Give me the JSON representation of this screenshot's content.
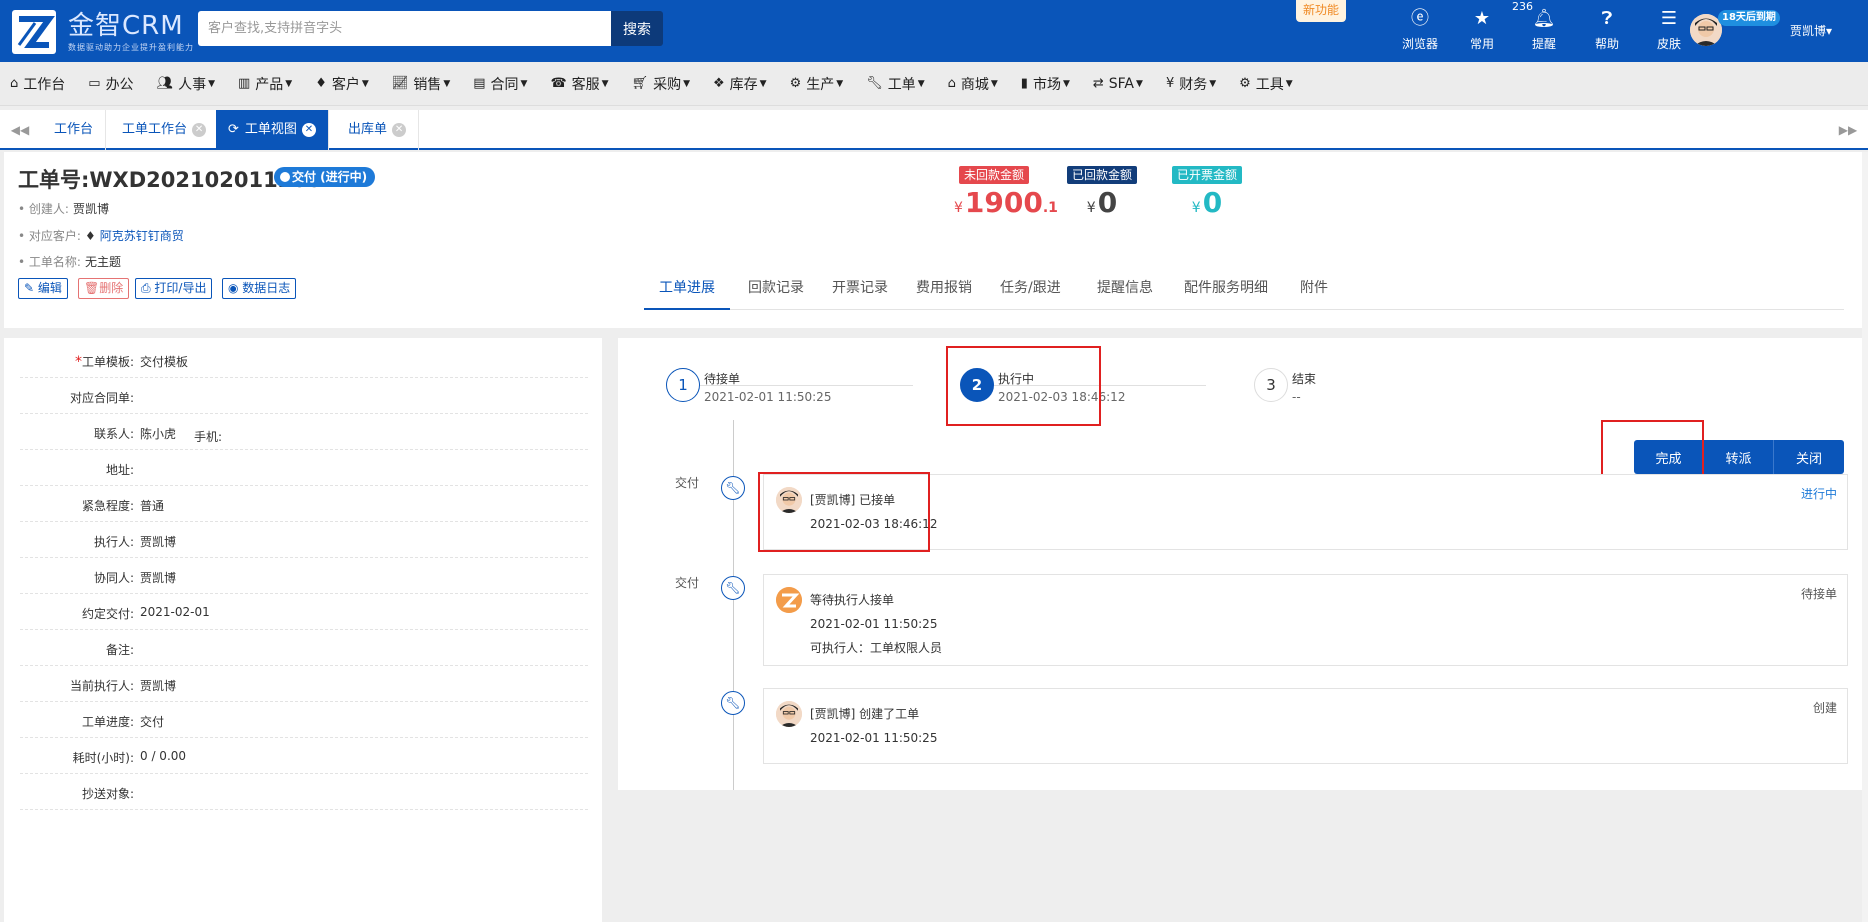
{
  "app": {
    "name": "金智CRM",
    "slogan": "数据驱动助力企业提升盈利能力",
    "search_placeholder": "客户查找,支持拼音字头",
    "search_button": "搜索",
    "new_feature": "新功能",
    "tools": [
      {
        "label": "浏览器",
        "icon": "browser-icon"
      },
      {
        "label": "常用",
        "icon": "star-icon"
      },
      {
        "label": "提醒",
        "icon": "bell-icon",
        "badge": "236"
      },
      {
        "label": "帮助",
        "icon": "help-icon"
      },
      {
        "label": "皮肤",
        "icon": "skin-icon"
      }
    ],
    "trial_badge": "18天后到期",
    "user": "贾凯博▾"
  },
  "menu": [
    {
      "label": "工作台",
      "icon": "home-icon",
      "dropdown": false
    },
    {
      "label": "办公",
      "icon": "laptop-icon",
      "dropdown": false
    },
    {
      "label": "人事",
      "icon": "users-icon",
      "dropdown": true
    },
    {
      "label": "产品",
      "icon": "barcode-icon",
      "dropdown": true
    },
    {
      "label": "客户",
      "icon": "diamond-icon",
      "dropdown": true
    },
    {
      "label": "销售",
      "icon": "chart-icon",
      "dropdown": true
    },
    {
      "label": "合同",
      "icon": "contract-icon",
      "dropdown": true
    },
    {
      "label": "客服",
      "icon": "phone-icon",
      "dropdown": true
    },
    {
      "label": "采购",
      "icon": "cart-icon",
      "dropdown": true
    },
    {
      "label": "库存",
      "icon": "cubes-icon",
      "dropdown": true
    },
    {
      "label": "生产",
      "icon": "cogs-icon",
      "dropdown": true
    },
    {
      "label": "工单",
      "icon": "wrench-icon",
      "dropdown": true
    },
    {
      "label": "商城",
      "icon": "shop-icon",
      "dropdown": true
    },
    {
      "label": "市场",
      "icon": "bookmark-icon",
      "dropdown": true
    },
    {
      "label": "SFA",
      "icon": "retweet-icon",
      "dropdown": true
    },
    {
      "label": "财务",
      "icon": "yen-icon",
      "dropdown": true
    },
    {
      "label": "工具",
      "icon": "gear-icon",
      "dropdown": true
    }
  ],
  "tabs": [
    {
      "label": "工作台",
      "closable": false,
      "active": false
    },
    {
      "label": "工单工作台",
      "closable": true,
      "active": false
    },
    {
      "label": "工单视图",
      "closable": true,
      "active": true
    },
    {
      "label": "出库单",
      "closable": true,
      "active": false
    }
  ],
  "order": {
    "title": "工单号:WXD2021020112002",
    "status": "交付 (进行中)",
    "creator_label": "创建人:",
    "creator": "贾凯博",
    "customer_label": "对应客户:",
    "customer": "阿克苏钉钉商贸",
    "name_label": "工单名称:",
    "name": "无主题",
    "actions": [
      "编辑",
      "删除",
      "打印/导出",
      "数据日志"
    ]
  },
  "amounts": [
    {
      "tag": "未回款金额",
      "currency": "¥",
      "value": "1900",
      "decimal": ".1",
      "color": "#e5484d"
    },
    {
      "tag": "已回款金额",
      "currency": "¥",
      "value": "0",
      "decimal": "",
      "color": "#123d7a"
    },
    {
      "tag": "已开票金额",
      "currency": "¥",
      "value": "0",
      "decimal": "",
      "color": "#23b9c4"
    }
  ],
  "subtabs": [
    "工单进展",
    "回款记录",
    "开票记录",
    "费用报销",
    "任务/跟进",
    "提醒信息",
    "配件服务明细",
    "附件"
  ],
  "fields": [
    {
      "label": "工单模板:",
      "value": "交付模板",
      "required": true
    },
    {
      "label": "对应合同单:",
      "value": ""
    },
    {
      "label": "联系人:",
      "value": "陈小虎",
      "extra": "手机:"
    },
    {
      "label": "地址:",
      "value": ""
    },
    {
      "label": "紧急程度:",
      "value": "普通"
    },
    {
      "label": "执行人:",
      "value": "贾凯博"
    },
    {
      "label": "协同人:",
      "value": "贾凯博"
    },
    {
      "label": "约定交付:",
      "value": "2021-02-01"
    },
    {
      "label": "备注:",
      "value": ""
    },
    {
      "label": "当前执行人:",
      "value": "贾凯博"
    },
    {
      "label": "工单进度:",
      "value": "交付"
    },
    {
      "label": "耗时(小时):",
      "value": "0 / 0.00"
    },
    {
      "label": "抄送对象:",
      "value": ""
    }
  ],
  "steps": [
    {
      "num": "1",
      "title": "待接单",
      "date": "2021-02-01 11:50:25"
    },
    {
      "num": "2",
      "title": "执行中",
      "date": "2021-02-03 18:46:12"
    },
    {
      "num": "3",
      "title": "结束",
      "date": "--"
    }
  ],
  "op_buttons": [
    "完成",
    "转派",
    "关闭"
  ],
  "timeline": [
    {
      "stage": "交付",
      "text": "[贾凯博] 已接单",
      "date": "2021-02-03 18:46:12",
      "extra": "",
      "status": "进行中"
    },
    {
      "stage": "交付",
      "text": "等待执行人接单",
      "date": "2021-02-01 11:50:25",
      "extra": "可执行人：工单权限人员",
      "status": "待接单"
    },
    {
      "stage": "",
      "text": "[贾凯博] 创建了工单",
      "date": "2021-02-01 11:50:25",
      "extra": "",
      "status": "创建"
    }
  ]
}
